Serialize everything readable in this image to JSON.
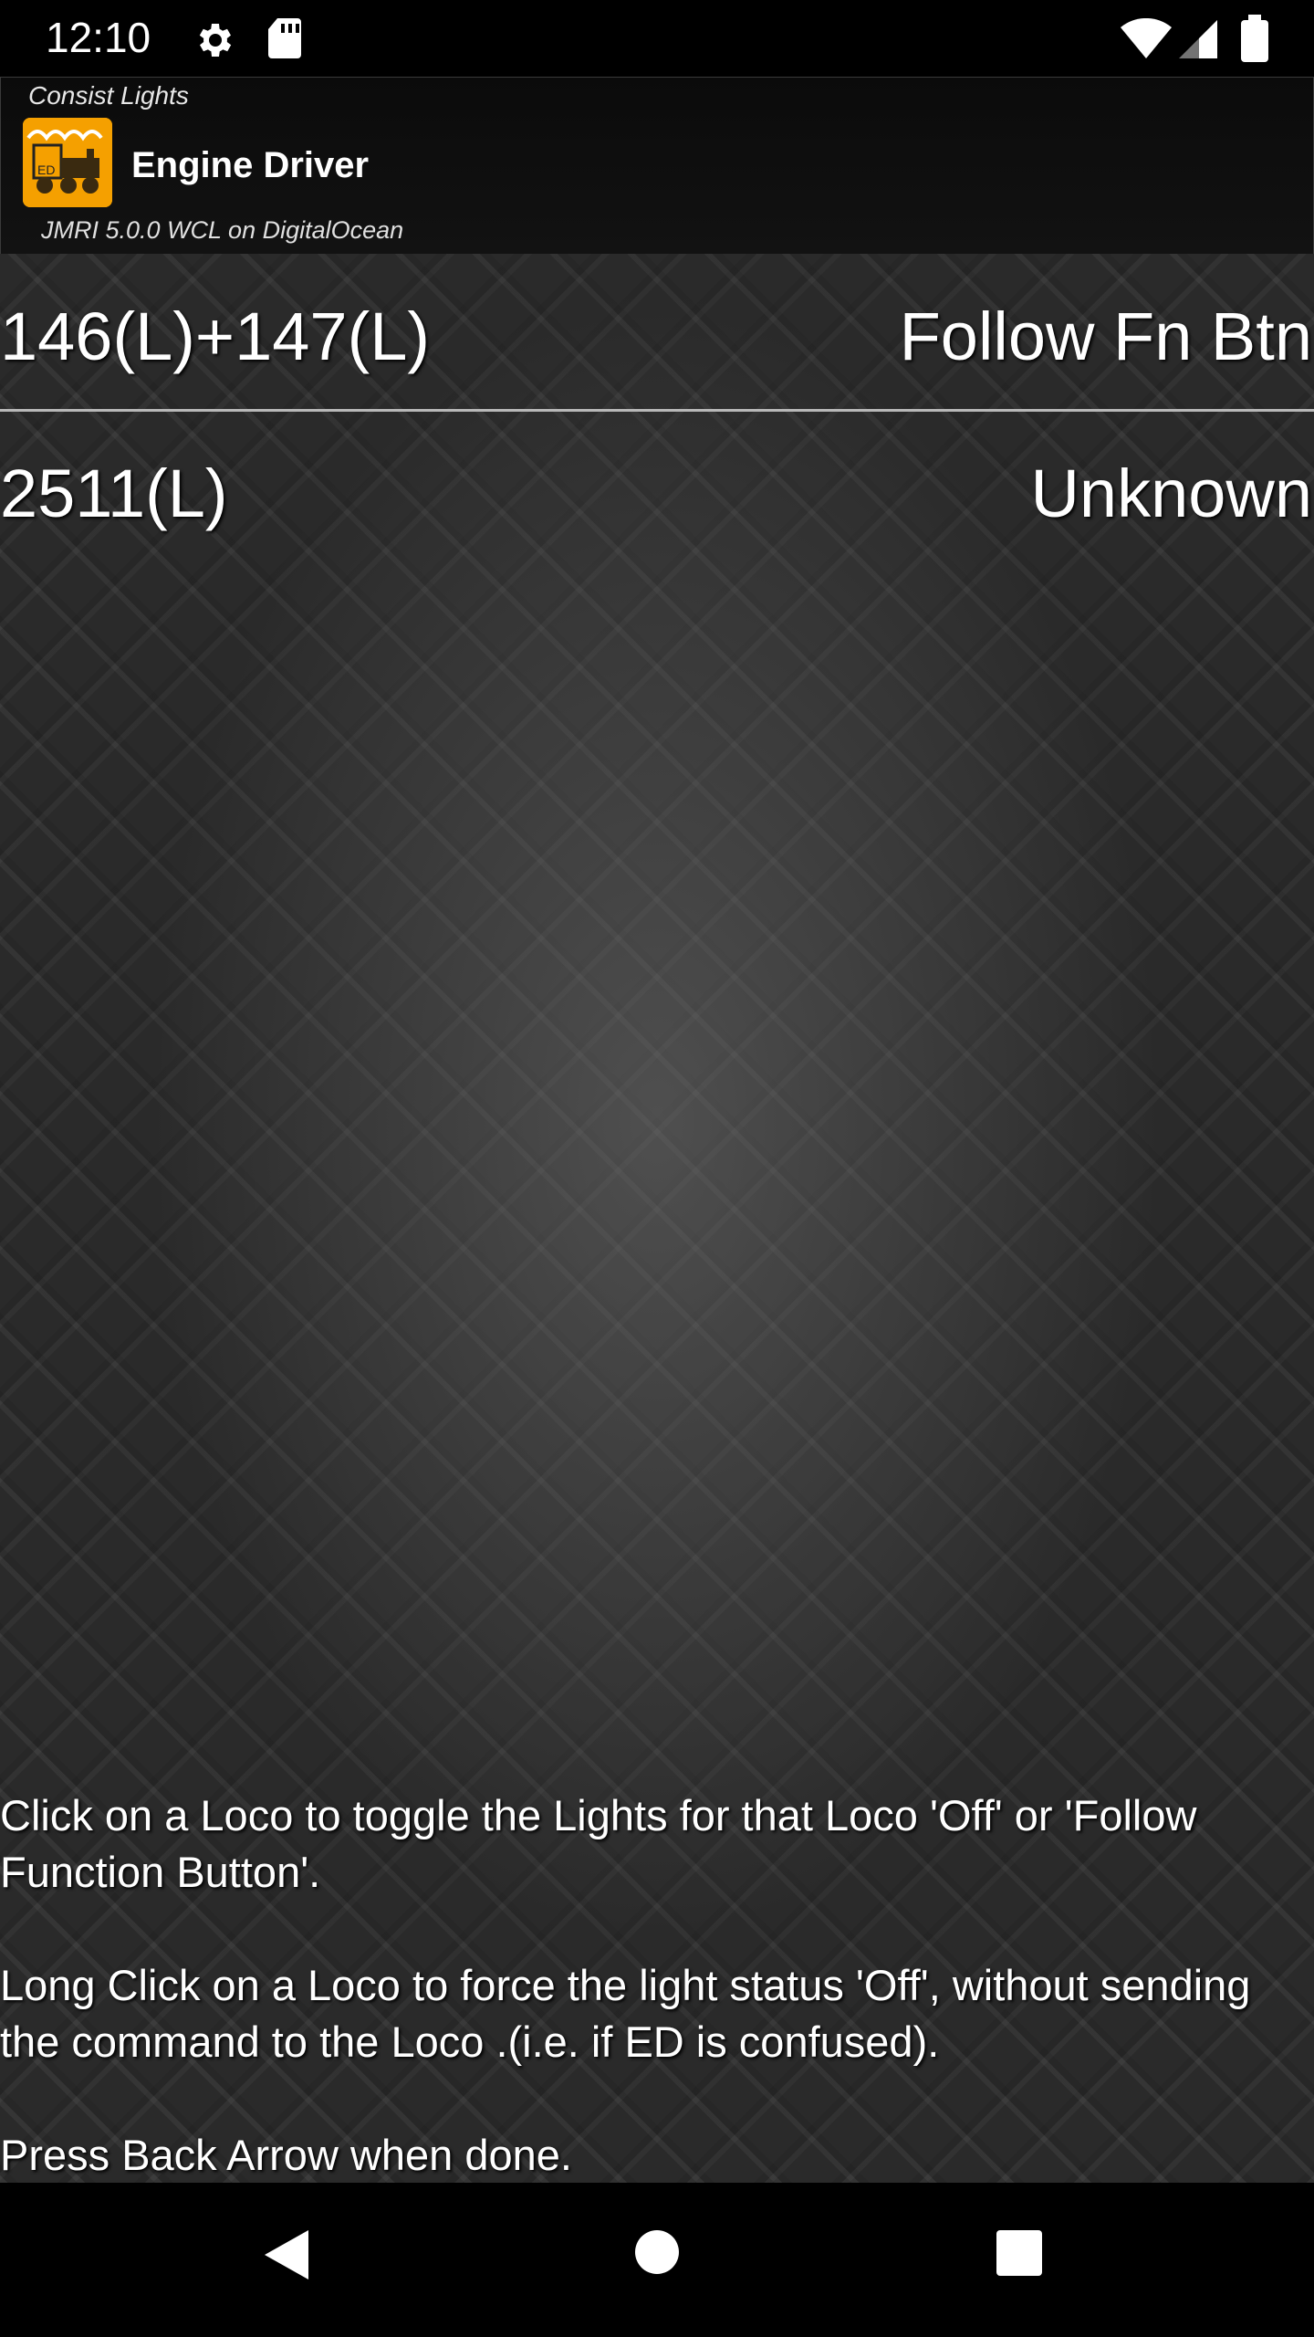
{
  "status_bar": {
    "time": "12:10",
    "icons": [
      "gear-icon",
      "sd-card-icon",
      "wifi-icon",
      "signal-icon",
      "battery-icon"
    ]
  },
  "header": {
    "subtitle": "Consist Lights",
    "title": "Engine Driver",
    "server": "JMRI 5.0.0 WCL on DigitalOcean",
    "logo_text": "ED",
    "logo_color": "#f5a000"
  },
  "locos": [
    {
      "id": "146(L)+147(L)",
      "status": "Follow Fn Btn"
    },
    {
      "id": "2511(L)",
      "status": "Unknown"
    }
  ],
  "help": {
    "line1": "Click on a Loco to toggle the Lights for that Loco 'Off' or 'Follow Function Button'.",
    "line2": "Long Click on a Loco to force the light status 'Off', without sending the command to the Loco .(i.e. if ED is confused).",
    "line3": "Press Back Arrow when done."
  },
  "nav": {
    "icons": [
      "back-icon",
      "home-icon",
      "recents-icon"
    ]
  }
}
